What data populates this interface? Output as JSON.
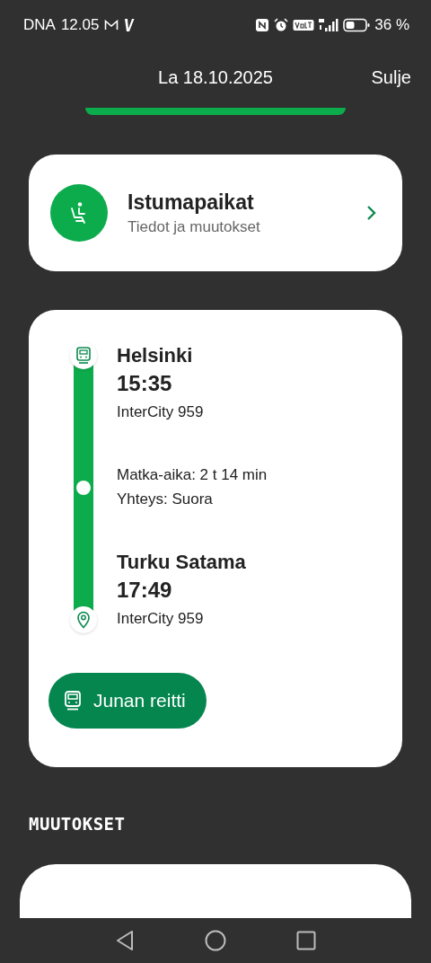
{
  "status_bar": {
    "carrier": "DNA",
    "time": "12.05",
    "battery": "36 %"
  },
  "header": {
    "title": "La 18.10.2025",
    "close": "Sulje"
  },
  "seats_card": {
    "title": "Istumapaikat",
    "subtitle": "Tiedot ja muutokset"
  },
  "journey": {
    "stops": [
      {
        "kind": "departure",
        "station": "Helsinki",
        "time": "15:35",
        "train": "InterCity 959"
      },
      {
        "kind": "arrival",
        "station": "Turku Satama",
        "time": "17:49",
        "train": "InterCity 959"
      }
    ],
    "details": [
      "Matka-aika: 2 t 14 min",
      "Yhteys: Suora"
    ],
    "route_button": "Junan reitti"
  },
  "changes": {
    "heading": "MUUTOKSET"
  }
}
